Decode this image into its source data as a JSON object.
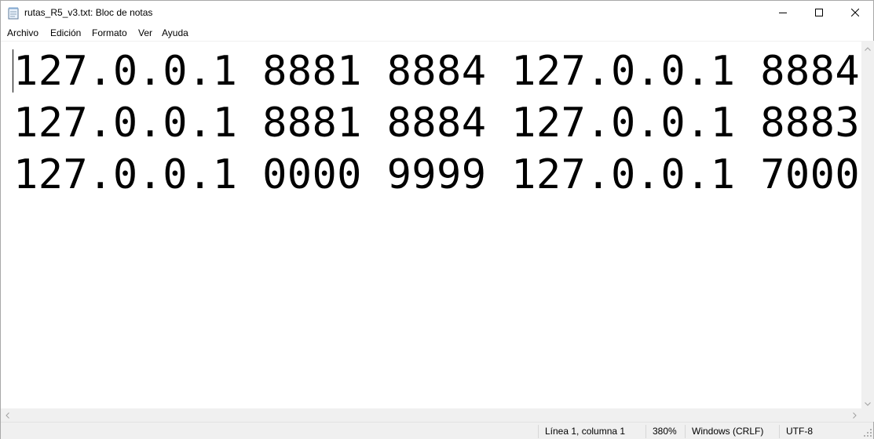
{
  "window": {
    "title": "rutas_R5_v3.txt: Bloc de notas",
    "icons": {
      "app": "notepad-icon",
      "minimize": "minimize-icon",
      "maximize": "maximize-icon",
      "close": "close-icon"
    }
  },
  "menu": {
    "items": [
      "Archivo",
      "Edición",
      "Formato",
      "Ver",
      "Ayuda"
    ]
  },
  "editor": {
    "lines": [
      "127.0.0.1 8881 8884 127.0.0.1 8884",
      "127.0.0.1 8881 8884 127.0.0.1 8883",
      "127.0.0.1 0000 9999 127.0.0.1 7000"
    ]
  },
  "status": {
    "position": "Línea 1, columna 1",
    "zoom": "380%",
    "line_endings": "Windows (CRLF)",
    "encoding": "UTF-8"
  },
  "colors": {
    "chrome": "#f0f0f0",
    "text": "#000000",
    "background": "#ffffff"
  }
}
